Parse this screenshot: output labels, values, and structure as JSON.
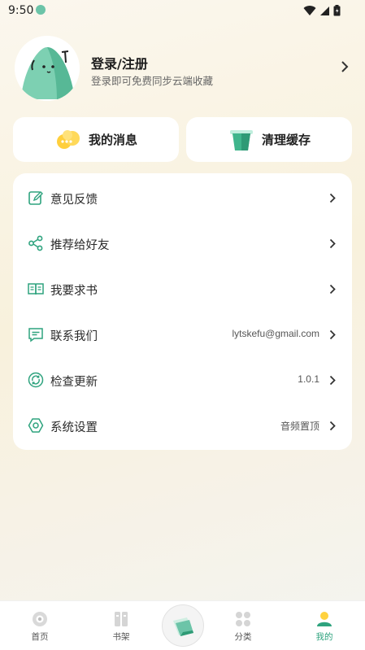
{
  "status_bar": {
    "time": "9:50"
  },
  "profile": {
    "title": "登录/注册",
    "subtitle": "登录即可免费同步云端收藏"
  },
  "quick_actions": [
    {
      "label": "我的消息"
    },
    {
      "label": "清理缓存"
    }
  ],
  "menu": [
    {
      "label": "意见反馈",
      "value": ""
    },
    {
      "label": "推荐给好友",
      "value": ""
    },
    {
      "label": "我要求书",
      "value": ""
    },
    {
      "label": "联系我们",
      "value": "lytskefu@gmail.com"
    },
    {
      "label": "检查更新",
      "value": "1.0.1"
    },
    {
      "label": "系统设置",
      "value": "音频置顶"
    }
  ],
  "bottom_nav": [
    {
      "label": "首页",
      "icon": "home-icon"
    },
    {
      "label": "书架",
      "icon": "bookshelf-icon"
    },
    {
      "label": "分类",
      "icon": "category-icon"
    },
    {
      "label": "我的",
      "icon": "profile-icon",
      "active": true
    }
  ],
  "colors": {
    "accent": "#2ea37e",
    "accent_light": "#6cc4a8"
  }
}
